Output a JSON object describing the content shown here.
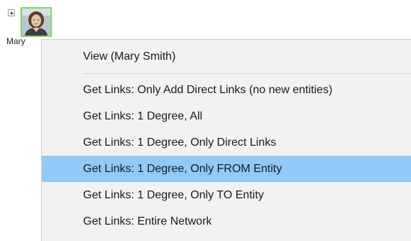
{
  "entity": {
    "name": "Mary",
    "expand_icon": "plus-box-icon",
    "avatar_icon": "person-photo-icon",
    "border_color": "#7ed957"
  },
  "menu": {
    "highlight_color": "#91c9f7",
    "items": [
      {
        "label": "View (Mary Smith)",
        "highlighted": false
      },
      {
        "label": "Get Links: Only Add Direct Links (no new entities)",
        "highlighted": false
      },
      {
        "label": "Get Links: 1 Degree, All",
        "highlighted": false
      },
      {
        "label": "Get Links: 1 Degree, Only Direct Links",
        "highlighted": false
      },
      {
        "label": "Get Links: 1 Degree, Only FROM Entity",
        "highlighted": true
      },
      {
        "label": "Get Links: 1 Degree, Only TO Entity",
        "highlighted": false
      },
      {
        "label": "Get Links: Entire Network",
        "highlighted": false
      }
    ]
  }
}
